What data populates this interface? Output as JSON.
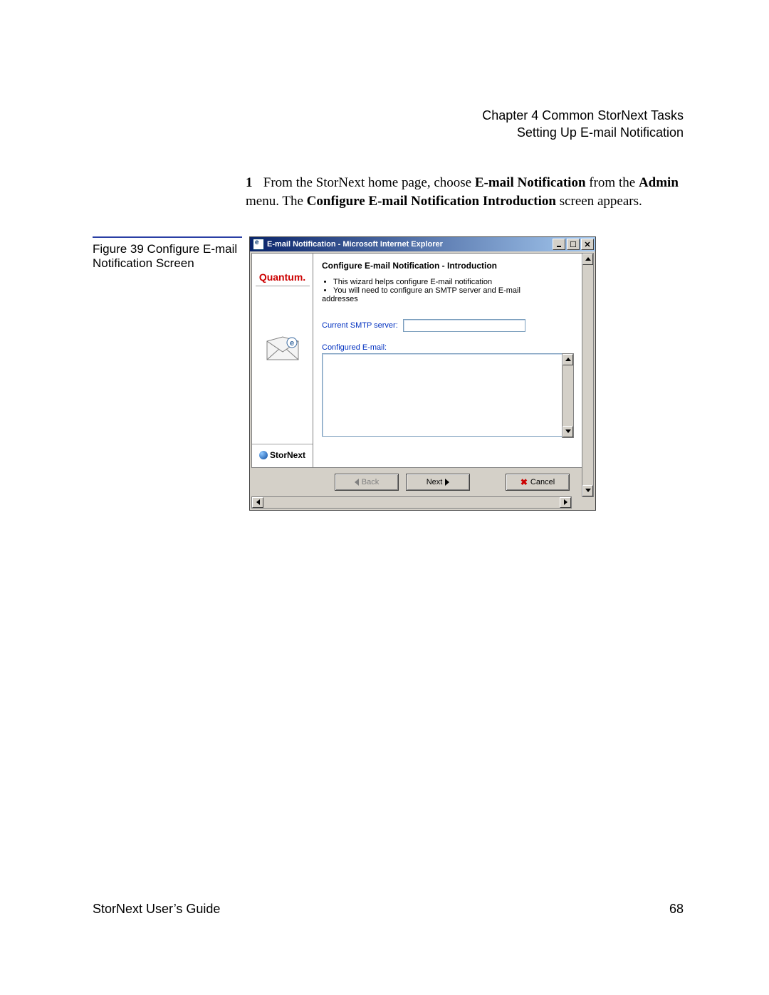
{
  "header": {
    "chapter": "Chapter 4  Common StorNext Tasks",
    "section": "Setting Up E-mail Notification"
  },
  "step": {
    "number": "1",
    "prefix": "From the StorNext home page, choose ",
    "bold1": "E-mail Notification",
    "mid1": " from the ",
    "bold2": "Admin",
    "mid2": " menu. The ",
    "bold3": "Configure E-mail Notification Introduction",
    "suffix": " screen appears."
  },
  "figure": {
    "caption": "Figure 39   Configure E-mail Notification Screen"
  },
  "window": {
    "title": "E-mail Notification - Microsoft Internet Explorer",
    "sidebar": {
      "brand": "Quantum.",
      "product": "StorNext"
    },
    "wizard": {
      "title": "Configure E-mail Notification - Introduction",
      "bullets": [
        "This wizard helps configure E-mail notification",
        "You will need to configure an SMTP server and E-mail"
      ],
      "bullets_trailing": "addresses",
      "smtp_label": "Current SMTP server:",
      "smtp_value": "",
      "configured_label": "Configured E-mail:",
      "configured_value": ""
    },
    "buttons": {
      "back": "Back",
      "next": "Next",
      "cancel": "Cancel"
    }
  },
  "footer": {
    "guide": "StorNext User’s Guide",
    "page": "68"
  }
}
